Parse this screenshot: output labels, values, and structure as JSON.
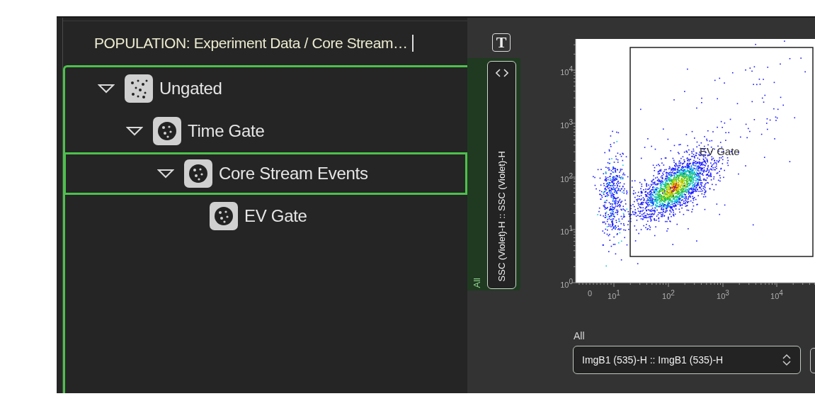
{
  "population_header": {
    "title": "POPULATION: Experiment Data / Core Stream…"
  },
  "tree": [
    {
      "label": "Ungated",
      "kind": "ungated",
      "expanded": true,
      "selected": false,
      "children": [
        {
          "label": "Time Gate",
          "kind": "gate",
          "expanded": true,
          "selected": false,
          "children": [
            {
              "label": "Core Stream Events",
              "kind": "gate",
              "expanded": true,
              "selected": true,
              "children": [
                {
                  "label": "EV Gate",
                  "kind": "gate",
                  "selected": false
                }
              ]
            }
          ]
        }
      ]
    }
  ],
  "plot": {
    "text_tool_icon": "T",
    "y_axis_gate": "All",
    "y_axis_parameter": "SSC (Violet)-H :: SSC (Violet)-H",
    "y_ticks": [
      "10$^{4}$",
      "10$^{3}$",
      "10$^{2}$",
      "10$^{1}$",
      "10$^{0}$"
    ],
    "x_ticks": [
      "0",
      "10$^{1}$",
      "10$^{2}$",
      "10$^{3}$",
      "10$^{4}$"
    ],
    "gate_label": "EV Gate",
    "x_axis_gate": "All",
    "x_axis_parameter": "ImgB1 (535)-H :: ImgB1 (535)-H"
  }
}
